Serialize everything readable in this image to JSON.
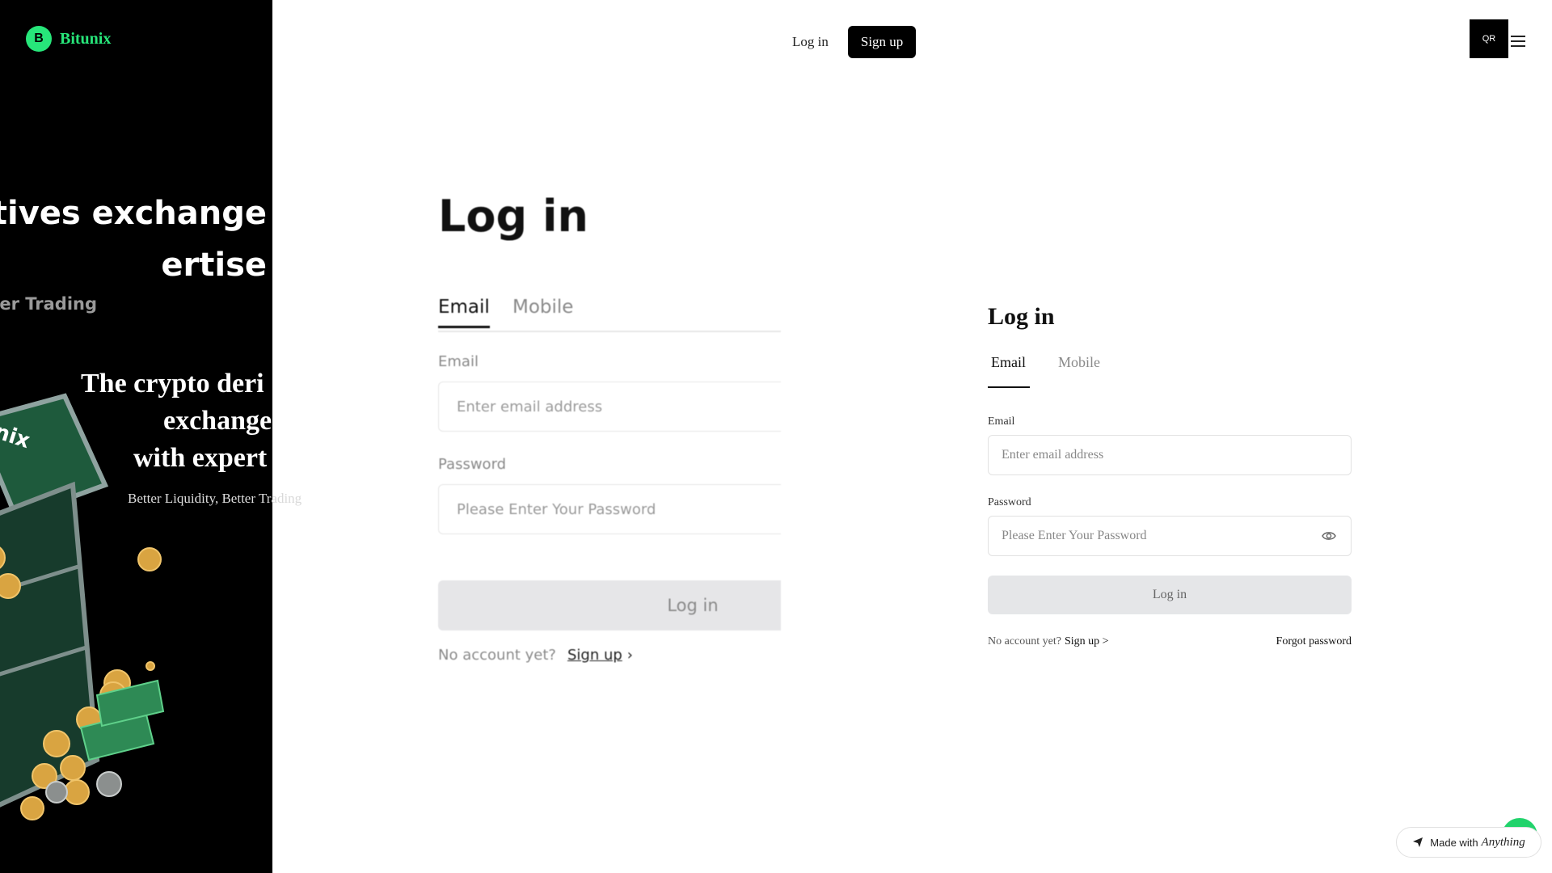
{
  "brand": {
    "logo_letter": "B",
    "name": "Bitunix",
    "accent": "#27e67a"
  },
  "hero": {
    "big_line1": "tives exchange",
    "big_line2": "ertise",
    "big_sub": "tter Trading",
    "serif_line1": "The crypto deri",
    "serif_line2": "exchange",
    "serif_line3": "with expert",
    "small_sub_a": "Better Liquidity, Better T",
    "small_sub_b": "rading"
  },
  "header": {
    "login_label": "Log in",
    "signup_label": "Sign up",
    "qr_label": "QR"
  },
  "ghost": {
    "title": "Log in",
    "tab_email": "Email",
    "tab_mobile": "Mobile",
    "email_label": "Email",
    "email_placeholder": "Enter email address",
    "password_label": "Password",
    "password_placeholder": "Please Enter Your Password",
    "login_button": "Log in",
    "no_account": "No account yet?",
    "signup_link": "Sign up"
  },
  "card": {
    "title": "Log in",
    "tab_email": "Email",
    "tab_mobile": "Mobile",
    "email_label": "Email",
    "email_placeholder": "Enter email address",
    "password_label": "Password",
    "password_placeholder": "Please Enter Your Password",
    "login_button": "Log in",
    "no_account": "No account yet?",
    "signup_link": "Sign up >",
    "forgot_link": "Forgot password"
  },
  "badge": {
    "made_with": "Made with",
    "brand": "Anything"
  }
}
